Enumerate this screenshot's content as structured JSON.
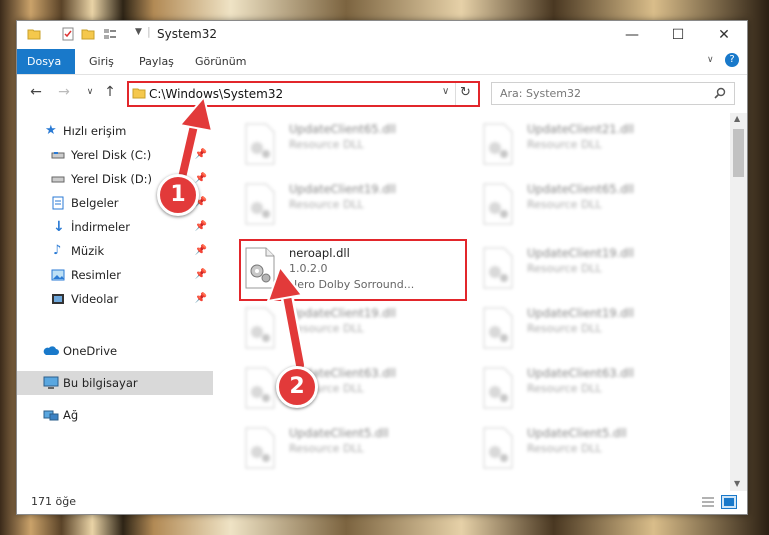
{
  "window": {
    "title": "System32",
    "min": "—",
    "max": "☐",
    "close": "✕"
  },
  "ribbon": {
    "tabs": [
      "Dosya",
      "Giriş",
      "Paylaş",
      "Görünüm"
    ],
    "help": "?"
  },
  "nav": {
    "address": "C:\\Windows\\System32",
    "search_placeholder": "Ara: System32"
  },
  "sidebar": {
    "items": [
      {
        "label": "Hızlı erişim",
        "icon": "star-icon"
      },
      {
        "label": "Yerel Disk (C:)",
        "icon": "drive-icon"
      },
      {
        "label": "Yerel Disk (D:)",
        "icon": "drive-icon"
      },
      {
        "label": "Belgeler",
        "icon": "documents-icon"
      },
      {
        "label": "İndirmeler",
        "icon": "download-icon"
      },
      {
        "label": "Müzik",
        "icon": "music-icon"
      },
      {
        "label": "Resimler",
        "icon": "pictures-icon"
      },
      {
        "label": "Videolar",
        "icon": "videos-icon"
      },
      {
        "label": "OneDrive",
        "icon": "cloud-icon"
      },
      {
        "label": "Bu bilgisayar",
        "icon": "computer-icon"
      },
      {
        "label": "Ağ",
        "icon": "network-icon"
      }
    ]
  },
  "files": {
    "left": [
      {
        "name": "UpdateClient65.dll",
        "type": "Resource DLL"
      },
      {
        "name": "UpdateClient19.dll",
        "type": "Resource DLL"
      },
      {
        "name": "neroapl.dll",
        "version": "1.0.2.0",
        "desc": "Nero Dolby Sorround..."
      },
      {
        "name": "UpdateClient19.dll",
        "type": "Resource DLL"
      },
      {
        "name": "UpdateClient63.dll",
        "type": "Resource DLL"
      },
      {
        "name": "UpdateClient5.dll",
        "type": "Resource DLL"
      }
    ],
    "right": [
      {
        "name": "UpdateClient21.dll",
        "type": "Resource DLL"
      },
      {
        "name": "UpdateClient65.dll",
        "type": "Resource DLL"
      },
      {
        "name": "UpdateClient19.dll",
        "type": "Resource DLL"
      },
      {
        "name": "UpdateClient19.dll",
        "type": "Resource DLL"
      },
      {
        "name": "UpdateClient63.dll",
        "type": "Resource DLL"
      },
      {
        "name": "UpdateClient5.dll",
        "type": "Resource DLL"
      }
    ]
  },
  "status": {
    "count": "171 öğe"
  },
  "annotations": {
    "step1": "1",
    "step2": "2",
    "color": "#e23a3a"
  }
}
